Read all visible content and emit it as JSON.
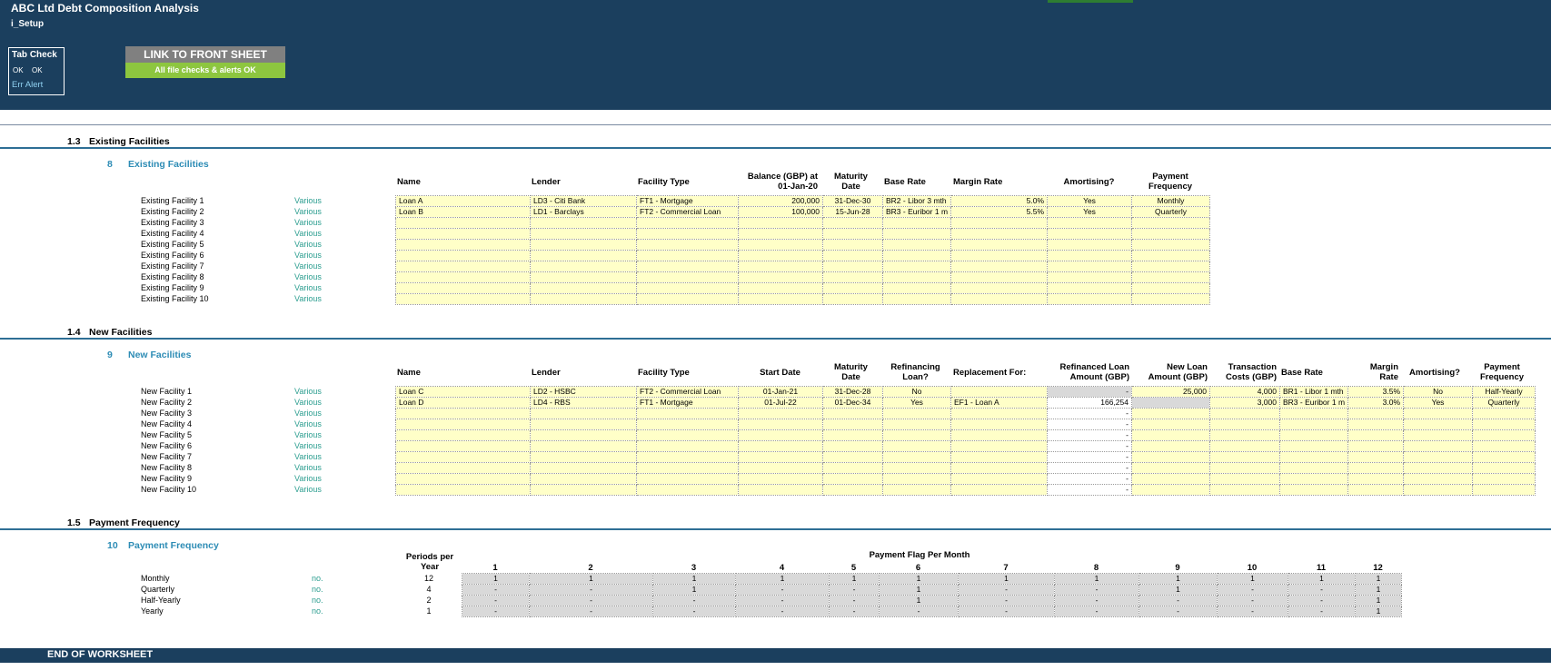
{
  "header": {
    "title": "ABC Ltd Debt Composition Analysis",
    "sheet": "i_Setup",
    "tab_check": {
      "title": "Tab Check",
      "ok1": "OK",
      "ok2": "OK",
      "err_alert": "Err  Alert"
    },
    "link_button": "LINK TO FRONT SHEET",
    "alert_status": "All file checks & alerts OK"
  },
  "existing": {
    "section_num": "1.3",
    "section_title": "Existing Facilities",
    "sub_num": "8",
    "sub_title": "Existing Facilities",
    "headers": {
      "name": "Name",
      "lender": "Lender",
      "type": "Facility Type",
      "balance1": "Balance (GBP) at",
      "balance2": "01-Jan-20",
      "maturity1": "Maturity",
      "maturity2": "Date",
      "base": "Base Rate",
      "margin": "Margin Rate",
      "amort": "Amortising?",
      "freq1": "Payment",
      "freq2": "Frequency"
    },
    "rows": [
      {
        "label": "Existing Facility 1",
        "various": "Various",
        "cells": [
          "Loan A",
          "LD3 - Citi Bank",
          "FT1 - Mortgage",
          "200,000",
          "31-Dec-30",
          "BR2 - Libor 3 mth",
          "5.0%",
          "Yes",
          "Monthly"
        ]
      },
      {
        "label": "Existing Facility 2",
        "various": "Various",
        "cells": [
          "Loan B",
          "LD1 - Barclays",
          "FT2 - Commercial Loan",
          "100,000",
          "15-Jun-28",
          "BR3 - Euribor 1 m",
          "5.5%",
          "Yes",
          "Quarterly"
        ]
      },
      {
        "label": "Existing Facility 3",
        "various": "Various",
        "cells": [
          "",
          "",
          "",
          "",
          "",
          "",
          "",
          "",
          ""
        ]
      },
      {
        "label": "Existing Facility 4",
        "various": "Various",
        "cells": [
          "",
          "",
          "",
          "",
          "",
          "",
          "",
          "",
          ""
        ]
      },
      {
        "label": "Existing Facility 5",
        "various": "Various",
        "cells": [
          "",
          "",
          "",
          "",
          "",
          "",
          "",
          "",
          ""
        ]
      },
      {
        "label": "Existing Facility 6",
        "various": "Various",
        "cells": [
          "",
          "",
          "",
          "",
          "",
          "",
          "",
          "",
          ""
        ]
      },
      {
        "label": "Existing Facility 7",
        "various": "Various",
        "cells": [
          "",
          "",
          "",
          "",
          "",
          "",
          "",
          "",
          ""
        ]
      },
      {
        "label": "Existing Facility 8",
        "various": "Various",
        "cells": [
          "",
          "",
          "",
          "",
          "",
          "",
          "",
          "",
          ""
        ]
      },
      {
        "label": "Existing Facility 9",
        "various": "Various",
        "cells": [
          "",
          "",
          "",
          "",
          "",
          "",
          "",
          "",
          ""
        ]
      },
      {
        "label": "Existing Facility 10",
        "various": "Various",
        "cells": [
          "",
          "",
          "",
          "",
          "",
          "",
          "",
          "",
          ""
        ]
      }
    ]
  },
  "newfac": {
    "section_num": "1.4",
    "section_title": "New Facilities",
    "sub_num": "9",
    "sub_title": "New Facilities",
    "headers": {
      "name": "Name",
      "lender": "Lender",
      "type": "Facility Type",
      "start": "Start Date",
      "maturity1": "Maturity",
      "maturity2": "Date",
      "refin1": "Refinancing",
      "refin2": "Loan?",
      "replacement": "Replacement For:",
      "refamt1": "Refinanced Loan",
      "refamt2": "Amount (GBP)",
      "newamt1": "New Loan",
      "newamt2": "Amount (GBP)",
      "tc1": "Transaction",
      "tc2": "Costs (GBP)",
      "base": "Base Rate",
      "margin1": "Margin",
      "margin2": "Rate",
      "amort": "Amortising?",
      "freq1": "Payment",
      "freq2": "Frequency"
    },
    "rows": [
      {
        "label": "New Facility 1",
        "various": "Various",
        "cells": [
          "Loan C",
          "LD2 - HSBC",
          "FT2 - Commercial Loan",
          "01-Jan-21",
          "31-Dec-28",
          "No",
          "",
          "-",
          "25,000",
          "4,000",
          "BR1 - Libor 1 mth",
          "3.5%",
          "No",
          "Half-Yearly"
        ]
      },
      {
        "label": "New Facility 2",
        "various": "Various",
        "cells": [
          "Loan D",
          "LD4 - RBS",
          "FT1 - Mortgage",
          "01-Jul-22",
          "01-Dec-34",
          "Yes",
          "EF1 - Loan A",
          "166,254",
          "",
          "3,000",
          "BR3 - Euribor 1 m",
          "3.0%",
          "Yes",
          "Quarterly"
        ]
      },
      {
        "label": "New Facility 3",
        "various": "Various",
        "cells": [
          "",
          "",
          "",
          "",
          "",
          "",
          "",
          "-",
          "",
          "",
          "",
          "",
          "",
          ""
        ]
      },
      {
        "label": "New Facility 4",
        "various": "Various",
        "cells": [
          "",
          "",
          "",
          "",
          "",
          "",
          "",
          "-",
          "",
          "",
          "",
          "",
          "",
          ""
        ]
      },
      {
        "label": "New Facility 5",
        "various": "Various",
        "cells": [
          "",
          "",
          "",
          "",
          "",
          "",
          "",
          "-",
          "",
          "",
          "",
          "",
          "",
          ""
        ]
      },
      {
        "label": "New Facility 6",
        "various": "Various",
        "cells": [
          "",
          "",
          "",
          "",
          "",
          "",
          "",
          "-",
          "",
          "",
          "",
          "",
          "",
          ""
        ]
      },
      {
        "label": "New Facility 7",
        "various": "Various",
        "cells": [
          "",
          "",
          "",
          "",
          "",
          "",
          "",
          "-",
          "",
          "",
          "",
          "",
          "",
          ""
        ]
      },
      {
        "label": "New Facility 8",
        "various": "Various",
        "cells": [
          "",
          "",
          "",
          "",
          "",
          "",
          "",
          "-",
          "",
          "",
          "",
          "",
          "",
          ""
        ]
      },
      {
        "label": "New Facility 9",
        "various": "Various",
        "cells": [
          "",
          "",
          "",
          "",
          "",
          "",
          "",
          "-",
          "",
          "",
          "",
          "",
          "",
          ""
        ]
      },
      {
        "label": "New Facility 10",
        "various": "Various",
        "cells": [
          "",
          "",
          "",
          "",
          "",
          "",
          "",
          "-",
          "",
          "",
          "",
          "",
          "",
          ""
        ]
      }
    ]
  },
  "payfreq": {
    "section_num": "1.5",
    "section_title": "Payment Frequency",
    "sub_num": "10",
    "sub_title": "Payment Frequency",
    "periods_header1": "Periods per",
    "periods_header2": "Year",
    "flag_header": "Payment Flag Per Month",
    "months": [
      "1",
      "2",
      "3",
      "4",
      "5",
      "6",
      "7",
      "8",
      "9",
      "10",
      "11",
      "12"
    ],
    "rows": [
      {
        "label": "Monthly",
        "unit": "no.",
        "periods": "12",
        "flags": [
          "1",
          "1",
          "1",
          "1",
          "1",
          "1",
          "1",
          "1",
          "1",
          "1",
          "1",
          "1"
        ]
      },
      {
        "label": "Quarterly",
        "unit": "no.",
        "periods": "4",
        "flags": [
          "-",
          "-",
          "1",
          "-",
          "-",
          "1",
          "-",
          "-",
          "1",
          "-",
          "-",
          "1"
        ]
      },
      {
        "label": "Half-Yearly",
        "unit": "no.",
        "periods": "2",
        "flags": [
          "-",
          "-",
          "-",
          "-",
          "-",
          "1",
          "-",
          "-",
          "-",
          "-",
          "-",
          "1"
        ]
      },
      {
        "label": "Yearly",
        "unit": "no.",
        "periods": "1",
        "flags": [
          "-",
          "-",
          "-",
          "-",
          "-",
          "-",
          "-",
          "-",
          "-",
          "-",
          "-",
          "1"
        ]
      }
    ]
  },
  "footer": "END OF WORKSHEET"
}
